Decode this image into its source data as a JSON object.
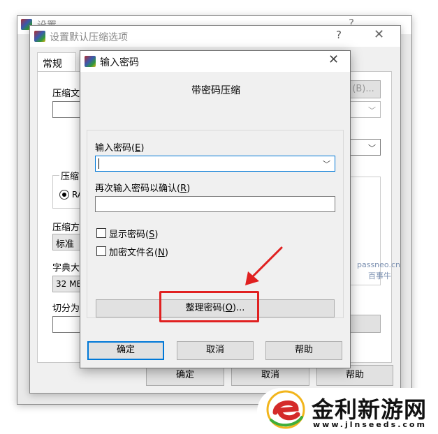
{
  "back_window": {
    "title": "设置",
    "help": "?"
  },
  "mid_window": {
    "title": "设置默认压缩选项",
    "help": "?",
    "close": "✕",
    "tab_general": "常规",
    "label_archive_name": "压缩文",
    "btn_browse": "(B)...",
    "label_format_group": "压缩",
    "radio_rar_label": "RA",
    "label_method": "压缩方",
    "method_value": "标准",
    "label_dict": "字典大",
    "dict_value": "32 MB",
    "label_split": "切分为",
    "watermark_site": "passneo.cn",
    "watermark_name": "百事牛",
    "ok": "确定",
    "cancel": "取消",
    "help_btn": "帮助"
  },
  "dialog": {
    "title": "输入密码",
    "close": "✕",
    "heading": "带密码压缩",
    "password_label": "输入密码",
    "password_hotkey": "E",
    "password_value": "",
    "confirm_label": "再次输入密码以确认",
    "confirm_hotkey": "R",
    "confirm_value": "",
    "show_password": "显示密码",
    "show_password_hotkey": "S",
    "encrypt_names": "加密文件名",
    "encrypt_names_hotkey": "N",
    "organize_label": "整理密码",
    "organize_hotkey": "O",
    "organize_suffix": "...",
    "ok": "确定",
    "cancel": "取消",
    "help": "帮助"
  },
  "brand": {
    "name": "金利新游网",
    "url": "www.jlnseeds.com"
  },
  "colors": {
    "annotation_red": "#e02020",
    "focus_blue": "#0078d7",
    "brand_red": "#d42a2a",
    "brand_green": "#3fae3a",
    "brand_yellow": "#f2b51c"
  }
}
